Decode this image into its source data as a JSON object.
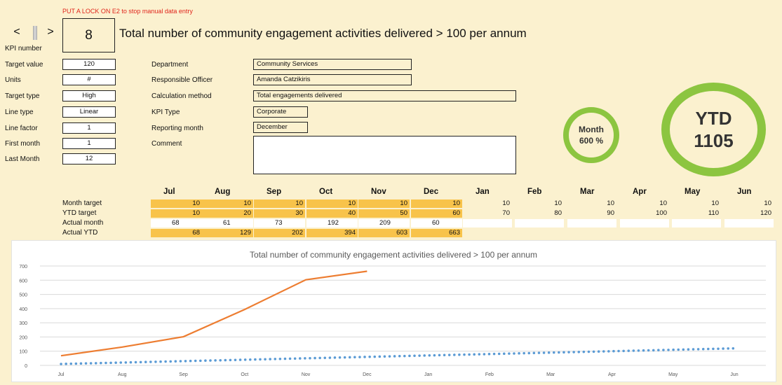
{
  "notice": "PUT A LOCK ON E2 to stop manual data entry",
  "nav": {
    "prev": "<",
    "next": ">"
  },
  "kpi": {
    "number": "8",
    "number_label": "KPI number",
    "title": "Total number of community engagement activities delivered > 100 per annum"
  },
  "left_fields": [
    {
      "label": "Target value",
      "value": "120"
    },
    {
      "label": "Units",
      "value": "#"
    },
    {
      "label": "Target type",
      "value": "High"
    },
    {
      "label": "Line type",
      "value": "Linear"
    },
    {
      "label": "Line factor",
      "value": "1"
    },
    {
      "label": "First month",
      "value": "1"
    },
    {
      "label": "Last Month",
      "value": "12"
    }
  ],
  "mid_fields": [
    {
      "label": "Department",
      "value": "Community Services"
    },
    {
      "label": "Responsible Officer",
      "value": "Amanda Catzikiris"
    },
    {
      "label": "Calculation method",
      "value": "Total engagements delivered"
    },
    {
      "label": "KPI Type",
      "value": "Corporate"
    },
    {
      "label": "Reporting month",
      "value": "December"
    },
    {
      "label": "Comment",
      "value": ""
    }
  ],
  "month_gauge": {
    "label": "Month",
    "value": "600 %"
  },
  "ytd_gauge": {
    "label": "YTD",
    "value": "1105"
  },
  "table": {
    "months": [
      "Jul",
      "Aug",
      "Sep",
      "Oct",
      "Nov",
      "Dec",
      "Jan",
      "Feb",
      "Mar",
      "Apr",
      "May",
      "Jun"
    ],
    "row_labels": [
      "Month target",
      "YTD target",
      "Actual month",
      "Actual YTD"
    ],
    "month_target": [
      "10",
      "10",
      "10",
      "10",
      "10",
      "10",
      "10",
      "10",
      "10",
      "10",
      "10",
      "10"
    ],
    "ytd_target": [
      "10",
      "20",
      "30",
      "40",
      "50",
      "60",
      "70",
      "80",
      "90",
      "100",
      "110",
      "120"
    ],
    "actual_month": [
      "68",
      "61",
      "73",
      "192",
      "209",
      "60",
      "",
      "",
      "",
      "",
      "",
      ""
    ],
    "actual_ytd": [
      "68",
      "129",
      "202",
      "394",
      "603",
      "663"
    ]
  },
  "chart_data": {
    "type": "line",
    "title": "Total number of community engagement activities delivered > 100 per annum",
    "categories": [
      "Jul",
      "Aug",
      "Sep",
      "Oct",
      "Nov",
      "Dec",
      "Jan",
      "Feb",
      "Mar",
      "Apr",
      "May",
      "Jun"
    ],
    "ylim": [
      0,
      700
    ],
    "yticks": [
      "0",
      "100",
      "200",
      "300",
      "400",
      "500",
      "600",
      "700"
    ],
    "grid": true,
    "series": [
      {
        "values": [
          68,
          129,
          202,
          394,
          603,
          663
        ],
        "color": "#ed7d31",
        "style": "solid"
      },
      {
        "values": [
          10,
          20,
          30,
          40,
          50,
          60,
          70,
          80,
          90,
          100,
          110,
          120
        ],
        "color": "#5b9bd5",
        "style": "dotted"
      }
    ]
  }
}
